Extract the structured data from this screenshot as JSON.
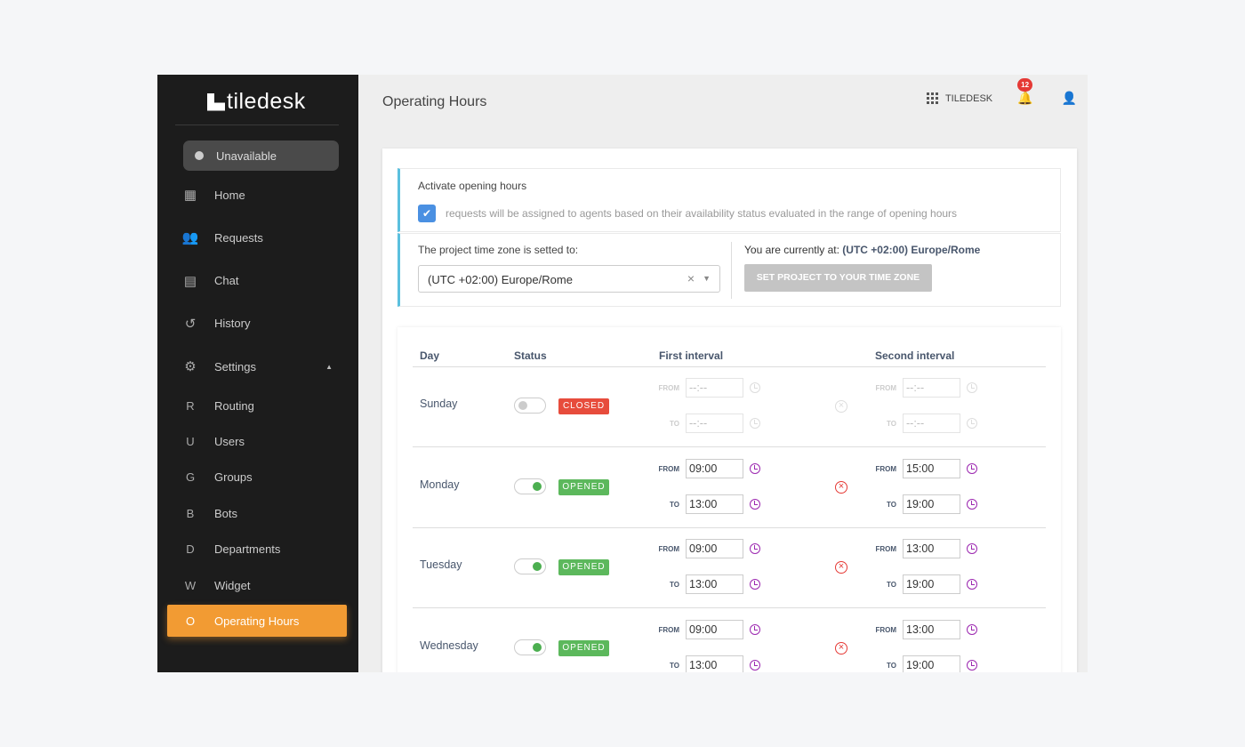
{
  "app": {
    "logo": "tiledesk",
    "title": "Operating Hours",
    "project": "TILEDESK",
    "notifications": "12"
  },
  "sidebar": {
    "status": "Unavailable",
    "items": [
      {
        "label": "Home",
        "icon": "dashboard-icon"
      },
      {
        "label": "Requests",
        "icon": "people-icon"
      },
      {
        "label": "Chat",
        "icon": "chat-icon"
      },
      {
        "label": "History",
        "icon": "history-icon"
      },
      {
        "label": "Settings",
        "icon": "gear-icon"
      }
    ],
    "sub": [
      {
        "letter": "R",
        "label": "Routing"
      },
      {
        "letter": "U",
        "label": "Users"
      },
      {
        "letter": "G",
        "label": "Groups"
      },
      {
        "letter": "B",
        "label": "Bots"
      },
      {
        "letter": "D",
        "label": "Departments"
      },
      {
        "letter": "W",
        "label": "Widget"
      },
      {
        "letter": "O",
        "label": "Operating Hours",
        "active": true
      }
    ]
  },
  "activate": {
    "title": "Activate opening hours",
    "checked": true,
    "description": "requests will be assigned to agents based on their availability status evaluated in the range of opening hours"
  },
  "timezone": {
    "label": "The project time zone is setted to:",
    "value": "(UTC +02:00) Europe/Rome",
    "current_label": "You are currently at:",
    "current_value": "(UTC +02:00) Europe/Rome",
    "button": "SET PROJECT TO YOUR TIME ZONE"
  },
  "table": {
    "headers": {
      "day": "Day",
      "status": "Status",
      "first": "First interval",
      "second": "Second interval"
    },
    "from": "FROM",
    "to": "TO",
    "rows": [
      {
        "day": "Sunday",
        "status": "CLOSED",
        "open": false,
        "f1": "--:--",
        "t1": "--:--",
        "f2": "--:--",
        "t2": "--:--"
      },
      {
        "day": "Monday",
        "status": "OPENED",
        "open": true,
        "f1": "09:00",
        "t1": "13:00",
        "f2": "15:00",
        "t2": "19:00"
      },
      {
        "day": "Tuesday",
        "status": "OPENED",
        "open": true,
        "f1": "09:00",
        "t1": "13:00",
        "f2": "13:00",
        "t2": "19:00"
      },
      {
        "day": "Wednesday",
        "status": "OPENED",
        "open": true,
        "f1": "09:00",
        "t1": "13:00",
        "f2": "13:00",
        "t2": "19:00"
      }
    ]
  },
  "colors": {
    "accent": "#f29b33",
    "opened": "#5cb85c",
    "closed": "#e74c3c",
    "clock": "#9c27b0"
  }
}
